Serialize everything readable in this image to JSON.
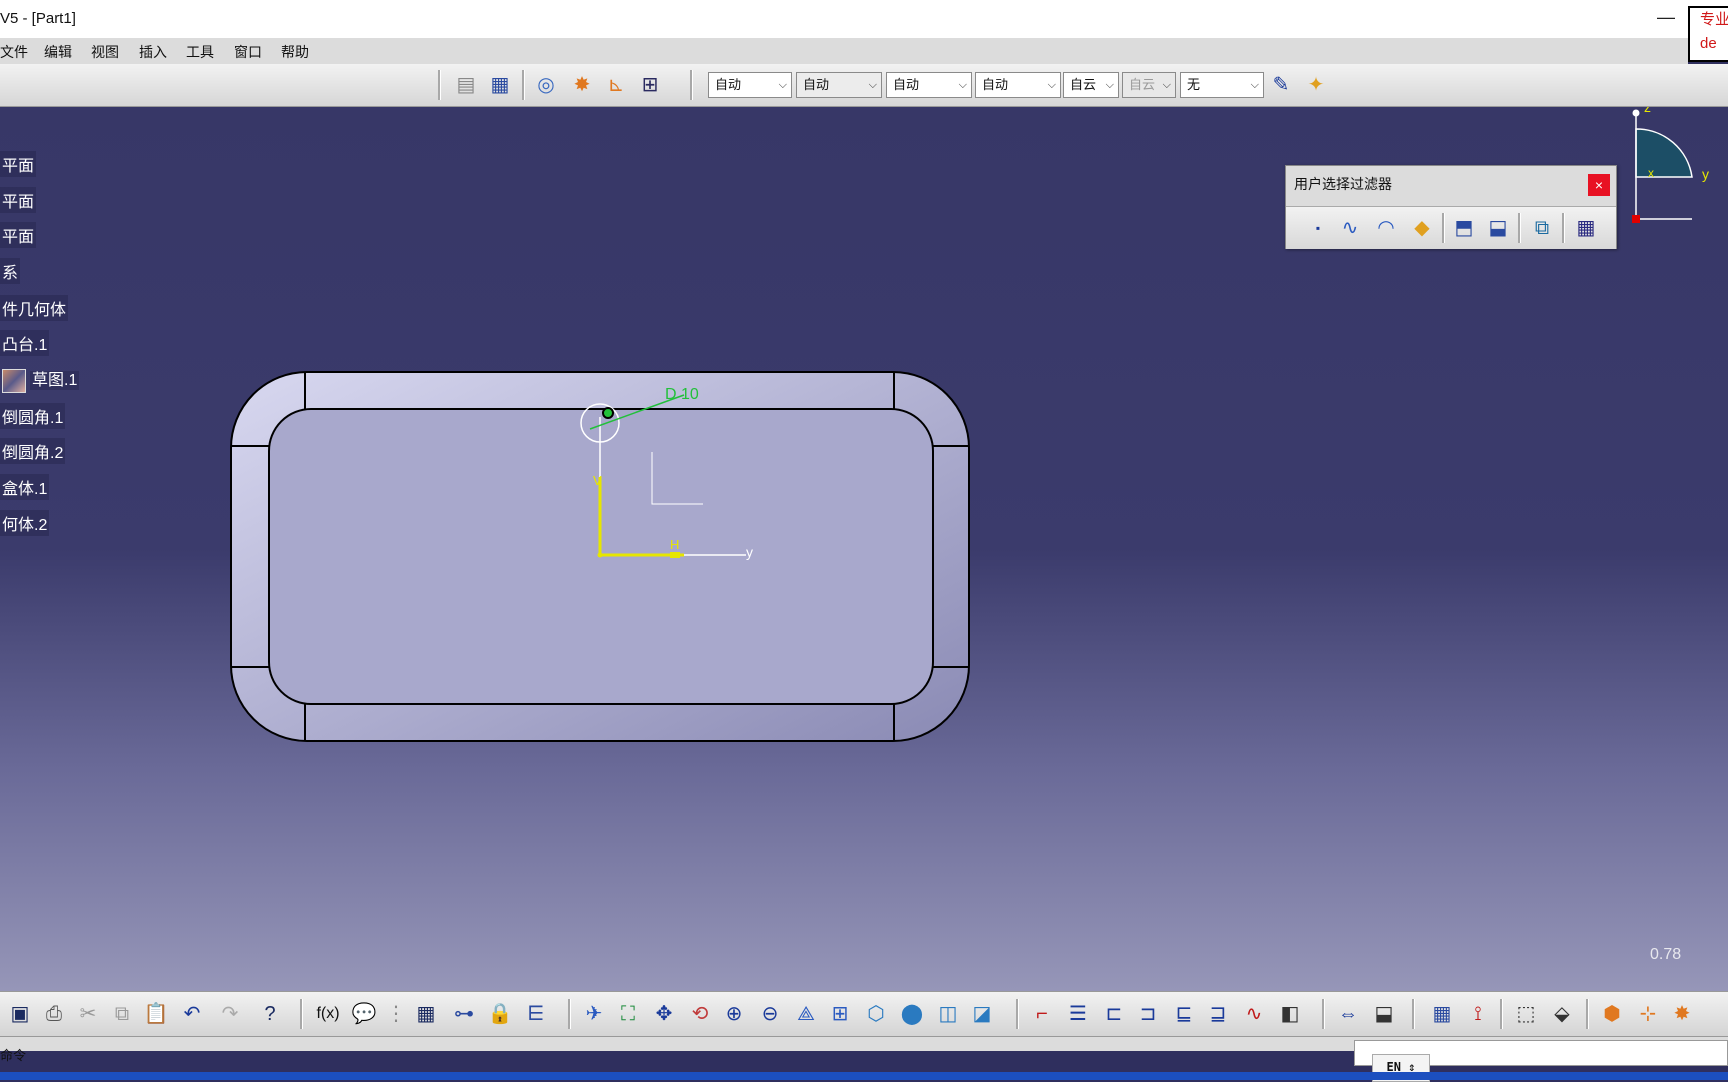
{
  "window": {
    "title": "V5 - [Part1]",
    "minimize_label": "—"
  },
  "promo": {
    "line1": "专业",
    "line2": "de"
  },
  "menu": [
    "文件",
    "编辑",
    "视图",
    "插入",
    "工具",
    "窗口",
    "帮助"
  ],
  "combos": [
    {
      "value": "自动",
      "disabled": false
    },
    {
      "value": "自动",
      "disabled": false
    },
    {
      "value": "自动",
      "disabled": false
    },
    {
      "value": "自动",
      "disabled": false
    },
    {
      "value": "自云",
      "disabled": false
    },
    {
      "value": "自云",
      "disabled": true
    },
    {
      "value": "无",
      "disabled": false
    }
  ],
  "tree": [
    "平面",
    "平面",
    "平面",
    "系",
    "件几何体",
    "凸台.1",
    "草图.1",
    "倒圆角.1",
    "倒圆角.2",
    "盒体.1",
    "何体.2"
  ],
  "filter_panel": {
    "title": "用户选择过滤器",
    "close": "×"
  },
  "sketch": {
    "dimension_label": "D 10",
    "v_label": "V",
    "h_label": "H",
    "y_axis_label": "y"
  },
  "compass": {
    "z": "z",
    "y": "y",
    "x": "x"
  },
  "zoom": "0.78",
  "status": {
    "command_label": "命令",
    "ime": "EN ⇕"
  },
  "colors": {
    "viewport_top": "#373767",
    "part_face": "#a8a8cc",
    "sketch_yellow": "#e6e600",
    "dimension_green": "#22c03a"
  }
}
